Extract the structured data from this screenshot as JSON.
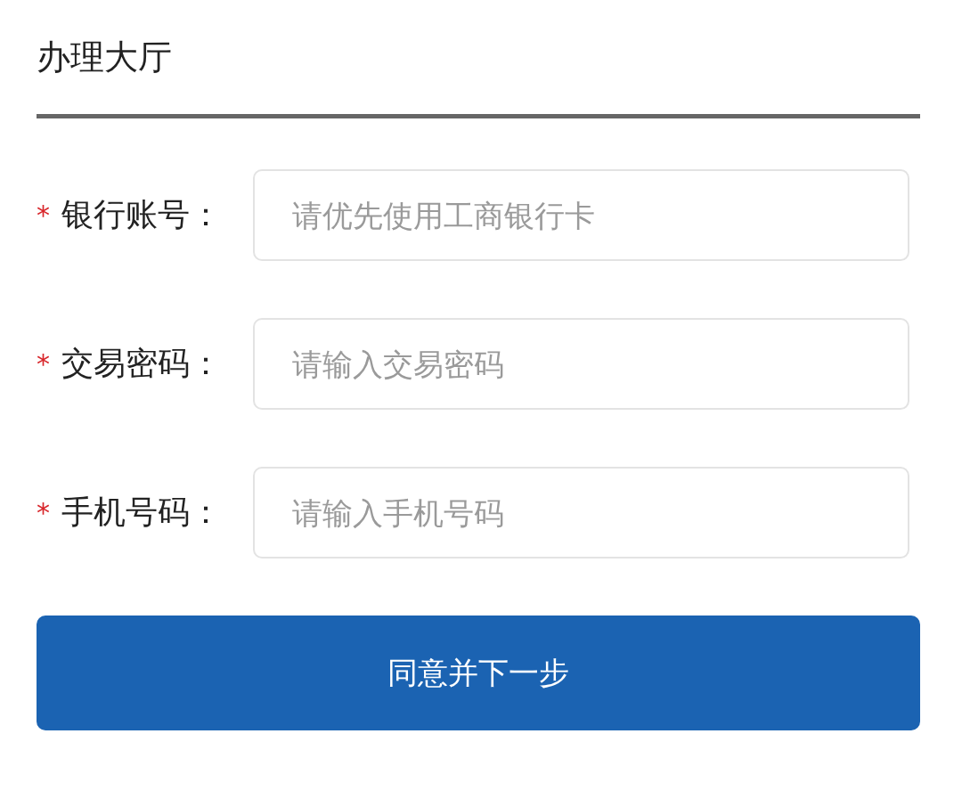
{
  "header": {
    "title": "办理大厅"
  },
  "fields": [
    {
      "marker": "*",
      "label": "银行账号：",
      "placeholder": "请优先使用工商银行卡"
    },
    {
      "marker": "*",
      "label": "交易密码：",
      "placeholder": "请输入交易密码"
    },
    {
      "marker": "*",
      "label": "手机号码：",
      "placeholder": "请输入手机号码"
    }
  ],
  "button": {
    "label": "同意并下一步"
  }
}
